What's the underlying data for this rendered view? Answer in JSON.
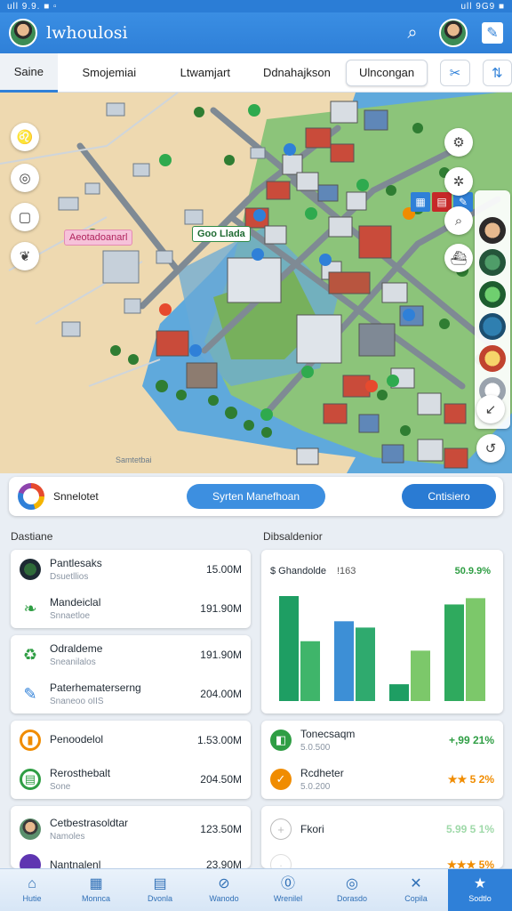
{
  "status": {
    "left": "ull 9.9. ■ ▫",
    "right": "ull 9G9 ■"
  },
  "header": {
    "title": "lwhoulosi"
  },
  "tabs": [
    {
      "label": "Saine"
    },
    {
      "label": "Smojemiai"
    },
    {
      "label": "Ltwamjart"
    },
    {
      "label": "Ddnahajkson"
    },
    {
      "label": "Ulncongan"
    }
  ],
  "map": {
    "labels": {
      "pink": "Aeotadoanarl",
      "green": "Goo Llada"
    },
    "watermark": "Samtetbai"
  },
  "strip": {
    "label": "Snnelotet",
    "button_one": "Syrten Manefhoan",
    "button_two": "Cntisiero"
  },
  "left_section_title": "Dastiane",
  "right_section_title": "Dibsaldenior",
  "left_cards": [
    {
      "rows": [
        {
          "name": "Pantlesaks",
          "sub": "Dsuetllios",
          "value": "15.00M",
          "icon": "landscape-icon"
        },
        {
          "name": "Mandeiclal",
          "sub": "Snnaetloe",
          "value": "191.90M",
          "icon": "leaf-icon"
        }
      ]
    },
    {
      "rows": [
        {
          "name": "Odraldeme",
          "sub": "Sneanilalos",
          "value": "191.90M",
          "icon": "recycle-icon"
        },
        {
          "name": "Paterhematerserng",
          "sub": "Snaneoo oIIS",
          "value": "204.00M",
          "icon": "pen-icon"
        }
      ]
    },
    {
      "rows": [
        {
          "name": "Penoodelol",
          "sub": "",
          "value": "1.53.00M",
          "icon": "orange-ring-icon"
        },
        {
          "name": "Rerosthebalt",
          "sub": "Sone",
          "value": "204.50M",
          "icon": "folder-icon"
        }
      ]
    },
    {
      "rows": [
        {
          "name": "Cetbestrasoldtar",
          "sub": "Namoles",
          "value": "123.50M",
          "icon": "person-icon"
        },
        {
          "name": "Nantnalenl",
          "sub": "",
          "value": "23.90M",
          "icon": "purple-dot-icon"
        }
      ]
    }
  ],
  "chart_card": {
    "name": "$ Ghandolde",
    "mid": "!163",
    "pct": "50.9.9%"
  },
  "chart_data": {
    "type": "bar",
    "title": "$ Ghandolde",
    "categories": [
      "",
      "",
      "",
      ""
    ],
    "series": [
      {
        "values": [
          100,
          0,
          0,
          0
        ],
        "color": "#1e9e63"
      },
      {
        "values": [
          57,
          0,
          0,
          0
        ],
        "color": "#3fb56a"
      },
      {
        "values": [
          0,
          76,
          0,
          0
        ],
        "color": "#3d8fd6"
      },
      {
        "values": [
          0,
          70,
          0,
          0
        ],
        "color": "#2faa6e"
      },
      {
        "values": [
          0,
          0,
          16,
          0
        ],
        "color": "#1e9e63"
      },
      {
        "values": [
          0,
          0,
          48,
          0
        ],
        "color": "#7cc86a"
      },
      {
        "values": [
          0,
          0,
          0,
          92
        ],
        "color": "#2faa5e"
      },
      {
        "values": [
          0,
          0,
          0,
          98
        ],
        "color": "#7cc86a"
      }
    ],
    "ylim": [
      0,
      100
    ],
    "grid": false
  },
  "right_cards": [
    {
      "rows": [
        {
          "name": "Tonecsaqm",
          "sub": "5.0.500",
          "value": "+,99 21%",
          "style": "green",
          "icon": "green-cube-icon"
        },
        {
          "name": "Rcdheter",
          "sub": "5.0.200",
          "value": "★★ 5 2%",
          "style": "orange",
          "icon": "orange-check-icon"
        }
      ]
    },
    {
      "rows": [
        {
          "name": "Fkori",
          "sub": "",
          "value": "5.99 5 1%",
          "style": "faded",
          "icon": "circle-plus-icon"
        },
        {
          "name": "",
          "sub": "",
          "value": "★★★ 5%",
          "style": "orange",
          "icon": "orange-star-icon"
        }
      ]
    }
  ],
  "bottom_nav": [
    {
      "label": "Hutie",
      "icon": "⌂"
    },
    {
      "label": "Monnca",
      "icon": "▦"
    },
    {
      "label": "Dvonla",
      "icon": "▤"
    },
    {
      "label": "Wanodo",
      "icon": "⊘"
    },
    {
      "label": "Wrenilel",
      "icon": "⓪"
    },
    {
      "label": "Dorasdo",
      "icon": "◎"
    },
    {
      "label": "Copila",
      "icon": "✕"
    },
    {
      "label": "Sodtlo",
      "icon": "★"
    }
  ]
}
